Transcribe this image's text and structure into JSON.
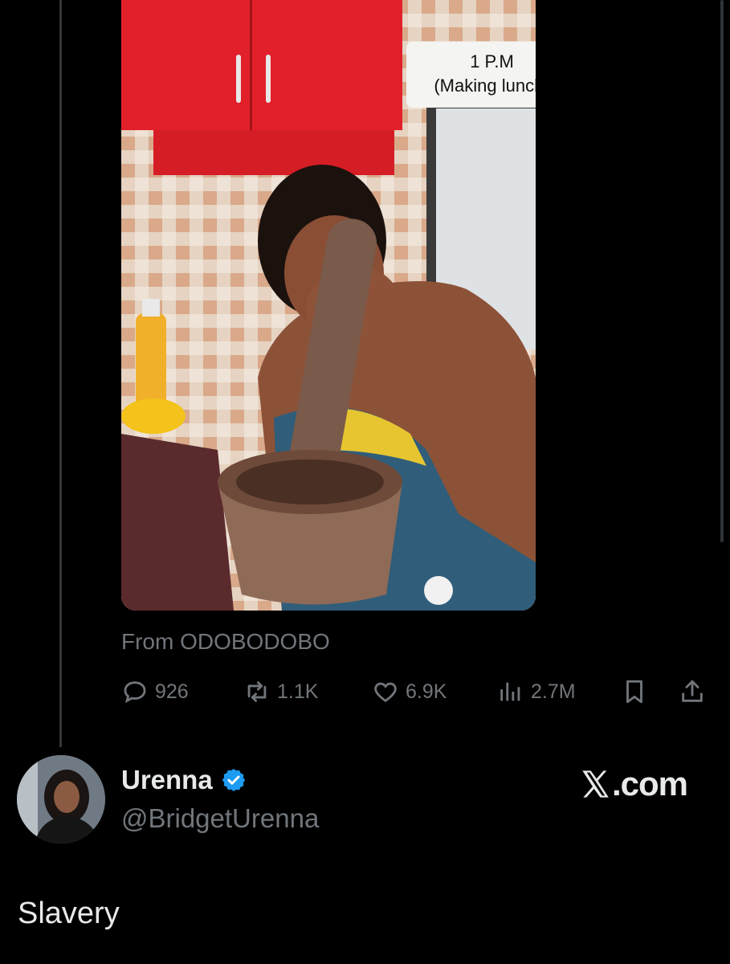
{
  "media": {
    "caption_line1": "1 P.M",
    "caption_line2": "(Making lunch)",
    "source": "From ODOBODOBO"
  },
  "actions": {
    "replies": "926",
    "reposts": "1.1K",
    "likes": "6.9K",
    "views": "2.7M"
  },
  "author": {
    "name": "Urenna",
    "handle": "@BridgetUrenna",
    "verified": true
  },
  "brand": {
    "logo_text": ".com"
  },
  "tweet": {
    "text": "Slavery"
  },
  "colors": {
    "background": "#000000",
    "text_primary": "#e7e9ea",
    "text_secondary": "#71767b",
    "verified_blue": "#1d9bf0"
  }
}
